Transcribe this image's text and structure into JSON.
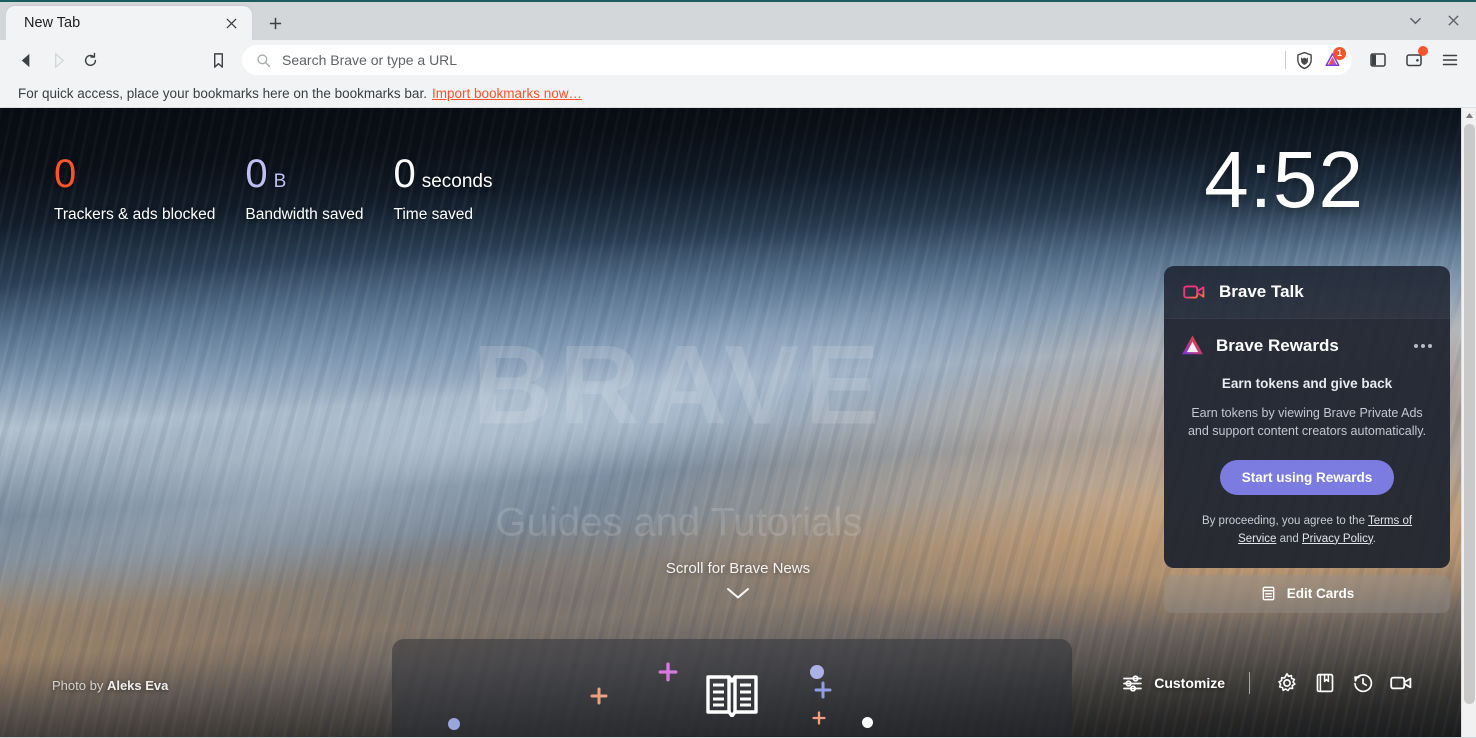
{
  "window": {
    "tab_title": "New Tab",
    "close_tab_label": "close-tab",
    "new_tab_label": "new-tab",
    "tab_search_label": "tab-search",
    "window_close_label": "close-window"
  },
  "toolbar": {
    "back_label": "Back",
    "forward_label": "Forward",
    "reload_label": "Reload",
    "bookmark_label": "Bookmark this tab",
    "omnibox_placeholder": "Search Brave or type a URL",
    "shields_label": "Brave Shields",
    "rewards_label": "Brave Rewards",
    "rewards_badge": "1",
    "sidebar_label": "Sidebar",
    "wallet_label": "Brave Wallet",
    "menu_label": "Customize and control Brave"
  },
  "bookmarks_bar": {
    "message": "For quick access, place your bookmarks here on the bookmarks bar.",
    "import_link": "Import bookmarks now…"
  },
  "ntp": {
    "watermark": "BRAVE",
    "watermark_sub": "Guides and Tutorials",
    "clock": "4:52",
    "stats": [
      {
        "value": "0",
        "unit": "",
        "label": "Trackers & ads blocked",
        "color": "#fb542b"
      },
      {
        "value": "0",
        "unit": "B",
        "label": "Bandwidth saved",
        "color": "#c0bff4"
      },
      {
        "value": "0",
        "unit": "seconds",
        "label": "Time saved",
        "color": "#ffffff"
      }
    ],
    "scroll_news": "Scroll for Brave News",
    "photo_credit_prefix": "Photo by ",
    "photo_credit_author": "Aleks Eva",
    "tools": {
      "customize": "Customize",
      "settings_label": "settings",
      "bookmarks_label": "bookmarks",
      "history_label": "history",
      "brave_talk_label": "brave-talk"
    }
  },
  "cards": {
    "talk": {
      "title": "Brave Talk"
    },
    "rewards": {
      "title": "Brave Rewards",
      "subtitle": "Earn tokens and give back",
      "body": "Earn tokens by viewing Brave Private Ads and support content creators automatically.",
      "cta": "Start using Rewards",
      "tos_prefix": "By proceeding, you agree to the ",
      "tos_link": "Terms of Service",
      "tos_mid": " and ",
      "privacy_link": "Privacy Policy",
      "tos_suffix": ".",
      "menu_label": "more-options"
    },
    "edit_cards": "Edit Cards"
  },
  "colors": {
    "accent_orange": "#fb542b",
    "rewards_purple": "#7c7ce0",
    "bandwidth_lavender": "#c0bff4"
  }
}
